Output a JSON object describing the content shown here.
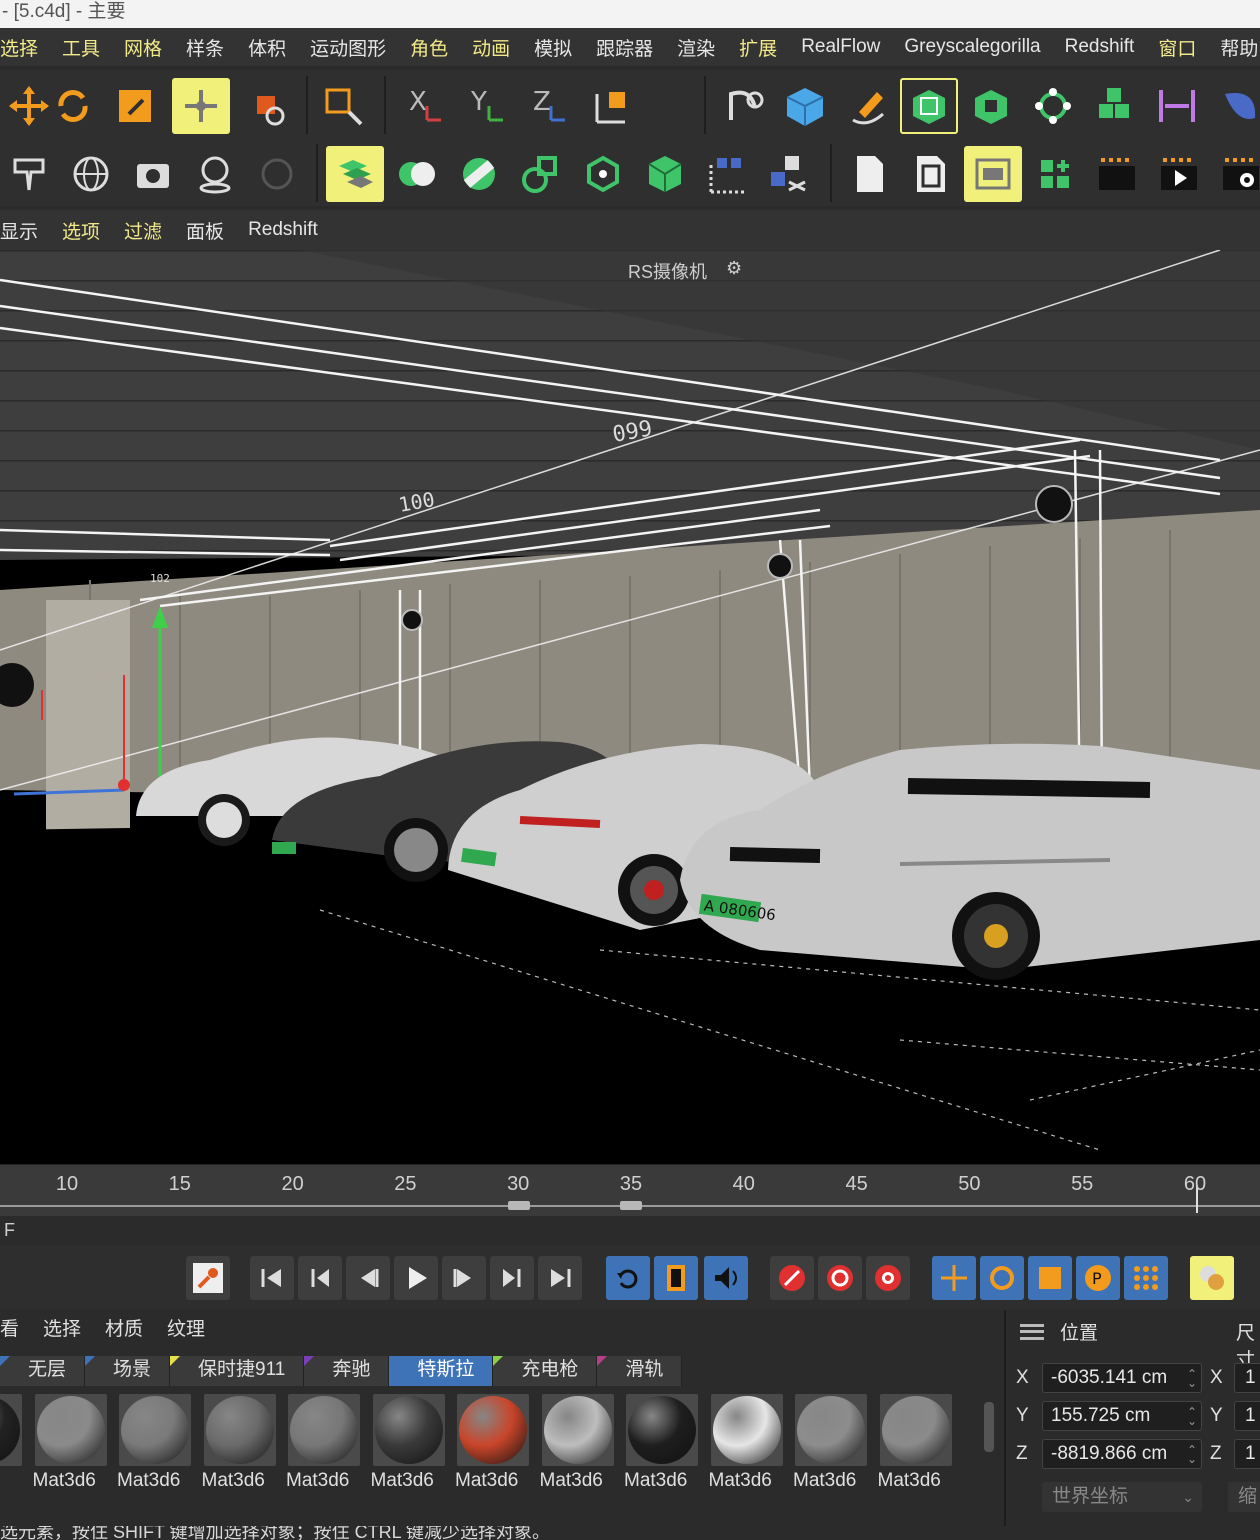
{
  "window": {
    "title": "- [5.c4d] - 主要"
  },
  "menubar": [
    {
      "label": "选择",
      "hl": true
    },
    {
      "label": "工具",
      "hl": true
    },
    {
      "label": "网格",
      "hl": true
    },
    {
      "label": "样条",
      "hl": false
    },
    {
      "label": "体积",
      "hl": false
    },
    {
      "label": "运动图形",
      "hl": false
    },
    {
      "label": "角色",
      "hl": true
    },
    {
      "label": "动画",
      "hl": true
    },
    {
      "label": "模拟",
      "hl": false
    },
    {
      "label": "跟踪器",
      "hl": false
    },
    {
      "label": "渲染",
      "hl": false
    },
    {
      "label": "扩展",
      "hl": true
    },
    {
      "label": "RealFlow",
      "hl": false
    },
    {
      "label": "Greyscalegorilla",
      "hl": false
    },
    {
      "label": "Redshift",
      "hl": false
    },
    {
      "label": "窗口",
      "hl": true
    },
    {
      "label": "帮助",
      "hl": false
    }
  ],
  "viewport_menu": [
    {
      "label": "显示",
      "hl": false
    },
    {
      "label": "选项",
      "hl": true
    },
    {
      "label": "过滤",
      "hl": true
    },
    {
      "label": "面板",
      "hl": false
    },
    {
      "label": "Redshift",
      "hl": false
    }
  ],
  "viewport": {
    "camera_label": "RS摄像机",
    "signs": [
      "099",
      "100",
      "102"
    ],
    "plates": [
      "A 080606"
    ]
  },
  "timeline": {
    "ticks": [
      "10",
      "15",
      "20",
      "25",
      "30",
      "35",
      "40",
      "45",
      "50",
      "55",
      "60"
    ],
    "frame_label": "F"
  },
  "materials": {
    "menu": [
      "看",
      "选择",
      "材质",
      "纹理"
    ],
    "layers": [
      {
        "label": "无层",
        "flag": "#3f73b8",
        "active": false
      },
      {
        "label": "场景",
        "flag": "#3f73b8",
        "active": false
      },
      {
        "label": "保时捷911",
        "flag": "#e8e04a",
        "active": false
      },
      {
        "label": "奔驰",
        "flag": "#7a3fb8",
        "active": false
      },
      {
        "label": "特斯拉",
        "flag": "#3f73b8",
        "active": true
      },
      {
        "label": "充电枪",
        "flag": "#8ad04a",
        "active": false
      },
      {
        "label": "滑轨",
        "flag": "#b83f8a",
        "active": false
      }
    ],
    "items": [
      {
        "name": "d6",
        "color": "#222"
      },
      {
        "name": "Mat3d6",
        "color": "#8a8a8a"
      },
      {
        "name": "Mat3d6",
        "color": "#7a7a7a"
      },
      {
        "name": "Mat3d6",
        "color": "#6a6a6a"
      },
      {
        "name": "Mat3d6",
        "color": "#777"
      },
      {
        "name": "Mat3d6",
        "color": "#3a3a3a"
      },
      {
        "name": "Mat3d6",
        "color": "#c9452a"
      },
      {
        "name": "Mat3d6",
        "color": "#bdbdbd"
      },
      {
        "name": "Mat3d6",
        "color": "#1e1e1e"
      },
      {
        "name": "Mat3d6",
        "color": "#e6e6e6"
      },
      {
        "name": "Mat3d6",
        "color": "#8d8d8d"
      },
      {
        "name": "Mat3d6",
        "color": "#8a8a8a"
      }
    ]
  },
  "attributes": {
    "header": "位置",
    "header2": "尺寸",
    "coords": [
      {
        "axis": "X",
        "value": "-6035.141 cm",
        "axis2": "X",
        "value2": "1"
      },
      {
        "axis": "Y",
        "value": "155.725 cm",
        "axis2": "Y",
        "value2": "1"
      },
      {
        "axis": "Z",
        "value": "-8819.866 cm",
        "axis2": "Z",
        "value2": "1"
      }
    ],
    "coord_system": "世界坐标",
    "scale_label": "缩"
  },
  "status": {
    "text": "选元素，按住 SHIFT 键增加选择对象；按住 CTRL 键减少选择对象。"
  }
}
